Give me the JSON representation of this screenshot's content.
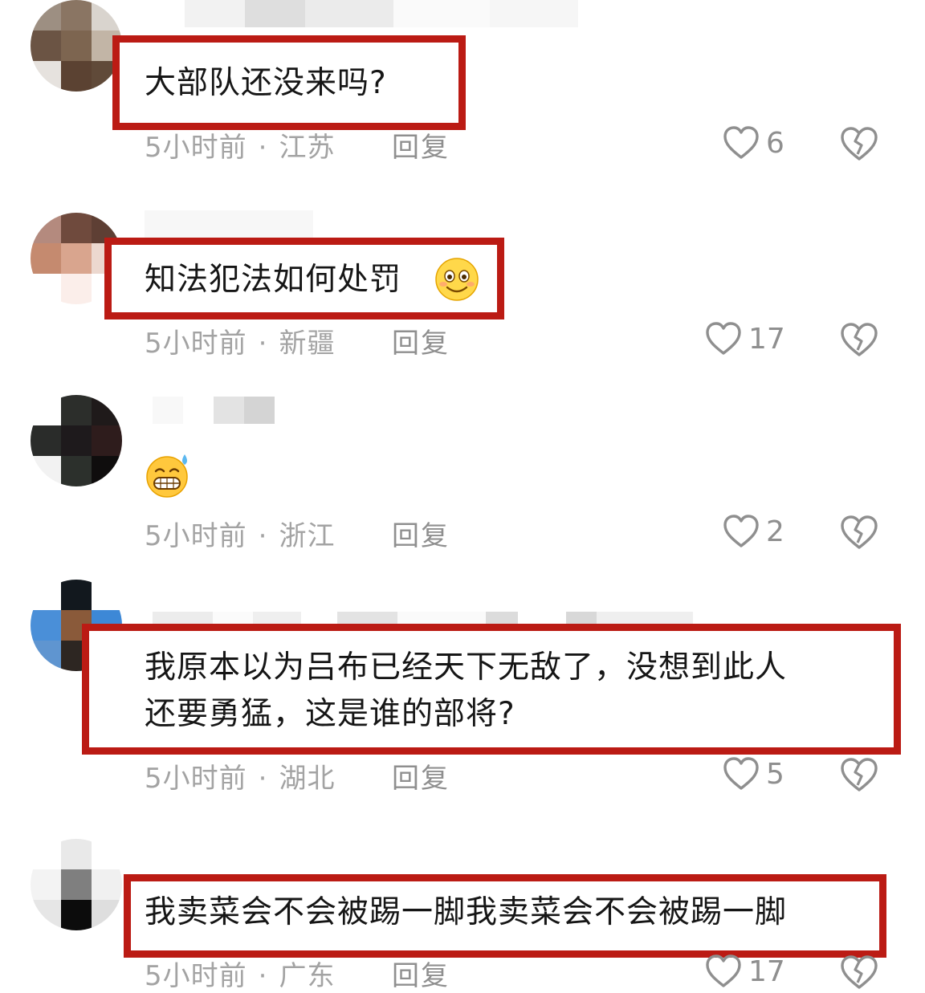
{
  "comments": [
    {
      "text": "大部队还没来吗?",
      "time": "5小时前",
      "dot": "·",
      "location": "江苏",
      "reply_label": "回复",
      "likes": "6"
    },
    {
      "text": "知法犯法如何处罚",
      "time": "5小时前",
      "dot": "·",
      "location": "新疆",
      "reply_label": "回复",
      "likes": "17"
    },
    {
      "text": "",
      "time": "5小时前",
      "dot": "·",
      "location": "浙江",
      "reply_label": "回复",
      "likes": "2"
    },
    {
      "text": "我原本以为吕布已经天下无敌了，没想到此人\n还要勇猛，这是谁的部将?",
      "time": "5小时前",
      "dot": "·",
      "location": "湖北",
      "reply_label": "回复",
      "likes": "5"
    },
    {
      "text": "我卖菜会不会被踢一脚我卖菜会不会被踢一脚",
      "time": "5小时前",
      "dot": "·",
      "location": "广东",
      "reply_label": "回复",
      "likes": "17"
    }
  ],
  "icons": {
    "like": "heart-outline-icon",
    "dislike": "broken-heart-icon",
    "emoji_smile": "shy-smile-emoji",
    "emoji_sweat": "sweat-grin-emoji"
  },
  "colors": {
    "highlight_box": "#bb1b14",
    "meta_text": "#a3a3a3",
    "body_text": "#161616"
  }
}
